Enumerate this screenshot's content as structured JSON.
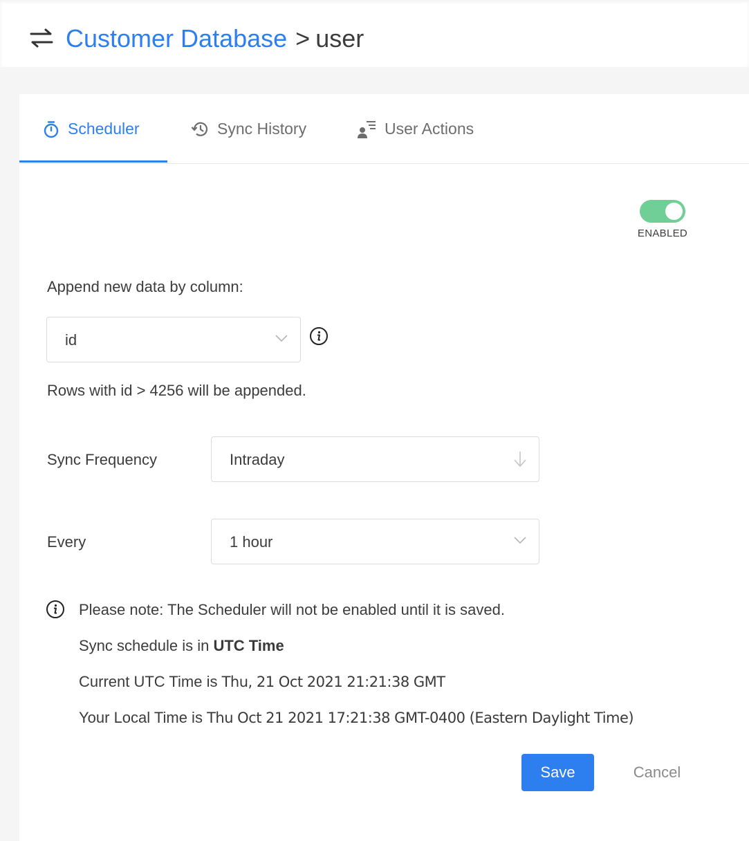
{
  "header": {
    "breadcrumb_db": "Customer Database",
    "breadcrumb_sep": ">",
    "breadcrumb_table": "user",
    "icon": "swap-arrows-icon"
  },
  "tabs": [
    {
      "label": "Scheduler",
      "icon": "stopwatch-icon",
      "active": true
    },
    {
      "label": "Sync History",
      "icon": "history-icon",
      "active": false
    },
    {
      "label": "User Actions",
      "icon": "user-list-icon",
      "active": false
    }
  ],
  "toggle": {
    "state": "on",
    "label": "ENABLED"
  },
  "append": {
    "label": "Append new data by column:",
    "column_value": "id",
    "rows_note": "Rows with id > 4256 will be appended."
  },
  "frequency": {
    "label": "Sync Frequency",
    "value": "Intraday"
  },
  "every": {
    "label": "Every",
    "value": "1 hour"
  },
  "notes": {
    "note_line": "Please note: The Scheduler will not be enabled until it is saved.",
    "schedule_prefix": "Sync schedule is in ",
    "schedule_tz": "UTC Time",
    "utc_prefix": "Current UTC Time is ",
    "utc_value": "Thu, 21 Oct 2021 21:21:38 GMT",
    "local_prefix": "Your Local Time is ",
    "local_value": "Thu Oct 21 2021 17:21:38 GMT-0400 (Eastern Daylight Time)"
  },
  "actions": {
    "save_label": "Save",
    "cancel_label": "Cancel"
  },
  "colors": {
    "accent": "#2d7ff0",
    "toggle_on": "#6fcf97"
  }
}
